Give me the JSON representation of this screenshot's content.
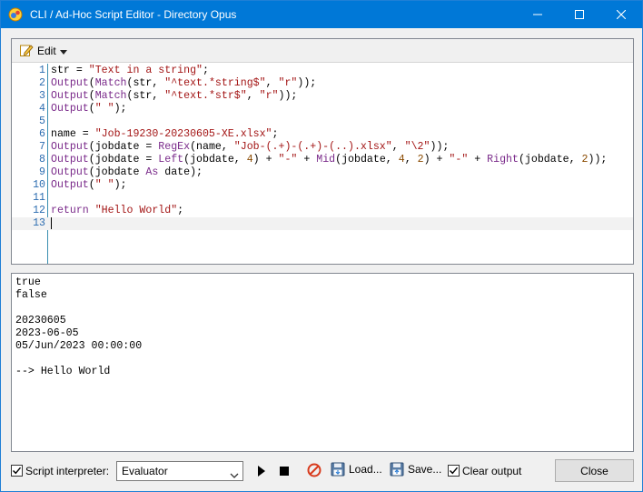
{
  "window": {
    "title": "CLI / Ad-Hoc Script Editor - Directory Opus"
  },
  "toolbar": {
    "edit_label": "Edit"
  },
  "editor": {
    "lines": [
      {
        "num": "1",
        "tokens": [
          [
            "id",
            "str = "
          ],
          [
            "str",
            "\"Text in a string\""
          ],
          [
            "id",
            ";"
          ]
        ]
      },
      {
        "num": "2",
        "tokens": [
          [
            "fn",
            "Output"
          ],
          [
            "id",
            "("
          ],
          [
            "fn",
            "Match"
          ],
          [
            "id",
            "(str, "
          ],
          [
            "str",
            "\"^text.*string$\""
          ],
          [
            "id",
            ", "
          ],
          [
            "str",
            "\"r\""
          ],
          [
            "id",
            "));"
          ]
        ]
      },
      {
        "num": "3",
        "tokens": [
          [
            "fn",
            "Output"
          ],
          [
            "id",
            "("
          ],
          [
            "fn",
            "Match"
          ],
          [
            "id",
            "(str, "
          ],
          [
            "str",
            "\"^text.*str$\""
          ],
          [
            "id",
            ", "
          ],
          [
            "str",
            "\"r\""
          ],
          [
            "id",
            "));"
          ]
        ]
      },
      {
        "num": "4",
        "tokens": [
          [
            "fn",
            "Output"
          ],
          [
            "id",
            "("
          ],
          [
            "str",
            "\" \""
          ],
          [
            "id",
            ");"
          ]
        ]
      },
      {
        "num": "5",
        "tokens": []
      },
      {
        "num": "6",
        "tokens": [
          [
            "id",
            "name = "
          ],
          [
            "str",
            "\"Job-19230-20230605-XE.xlsx\""
          ],
          [
            "id",
            ";"
          ]
        ]
      },
      {
        "num": "7",
        "tokens": [
          [
            "fn",
            "Output"
          ],
          [
            "id",
            "(jobdate = "
          ],
          [
            "fn",
            "RegEx"
          ],
          [
            "id",
            "(name, "
          ],
          [
            "str",
            "\"Job-(.+)-(.+)-(..).xlsx\""
          ],
          [
            "id",
            ", "
          ],
          [
            "str",
            "\"\\2\""
          ],
          [
            "id",
            "));"
          ]
        ]
      },
      {
        "num": "8",
        "tokens": [
          [
            "fn",
            "Output"
          ],
          [
            "id",
            "(jobdate = "
          ],
          [
            "fn",
            "Left"
          ],
          [
            "id",
            "(jobdate, "
          ],
          [
            "num",
            "4"
          ],
          [
            "id",
            ") + "
          ],
          [
            "str",
            "\"-\""
          ],
          [
            "id",
            " + "
          ],
          [
            "fn",
            "Mid"
          ],
          [
            "id",
            "(jobdate, "
          ],
          [
            "num",
            "4"
          ],
          [
            "id",
            ", "
          ],
          [
            "num",
            "2"
          ],
          [
            "id",
            ") + "
          ],
          [
            "str",
            "\"-\""
          ],
          [
            "id",
            " + "
          ],
          [
            "fn",
            "Right"
          ],
          [
            "id",
            "(jobdate, "
          ],
          [
            "num",
            "2"
          ],
          [
            "id",
            "));"
          ]
        ]
      },
      {
        "num": "9",
        "tokens": [
          [
            "fn",
            "Output"
          ],
          [
            "id",
            "(jobdate "
          ],
          [
            "kw",
            "As"
          ],
          [
            "id",
            " date);"
          ]
        ]
      },
      {
        "num": "10",
        "tokens": [
          [
            "fn",
            "Output"
          ],
          [
            "id",
            "("
          ],
          [
            "str",
            "\" \""
          ],
          [
            "id",
            ");"
          ]
        ]
      },
      {
        "num": "11",
        "tokens": []
      },
      {
        "num": "12",
        "tokens": [
          [
            "kw",
            "return"
          ],
          [
            "id",
            " "
          ],
          [
            "str",
            "\"Hello World\""
          ],
          [
            "id",
            ";"
          ]
        ]
      },
      {
        "num": "13",
        "tokens": [],
        "current": true
      }
    ]
  },
  "output": {
    "lines": [
      "true",
      "false",
      "",
      "20230605",
      "2023-06-05",
      "05/Jun/2023 00:00:00",
      "",
      "--> Hello World"
    ]
  },
  "bottom": {
    "script_interpreter_label": "Script interpreter:",
    "script_interpreter_checked": true,
    "interpreter_value": "Evaluator",
    "load_label": "Load...",
    "save_label": "Save...",
    "clear_output_label": "Clear output",
    "clear_output_checked": true,
    "close_label": "Close"
  },
  "icons": {
    "app": "directory-opus-app-icon",
    "edit": "pencil-edit-icon",
    "run": "play-icon",
    "stop": "stop-icon",
    "clear": "no-entry-icon",
    "load": "load-floppy-icon",
    "save": "save-floppy-icon"
  },
  "colors": {
    "titlebar": "#0078d7",
    "string": "#a31515",
    "function": "#7a2a8a",
    "number": "#8a4a00",
    "line_number": "#2b6cb0",
    "clear_icon": "#d83b1d"
  }
}
